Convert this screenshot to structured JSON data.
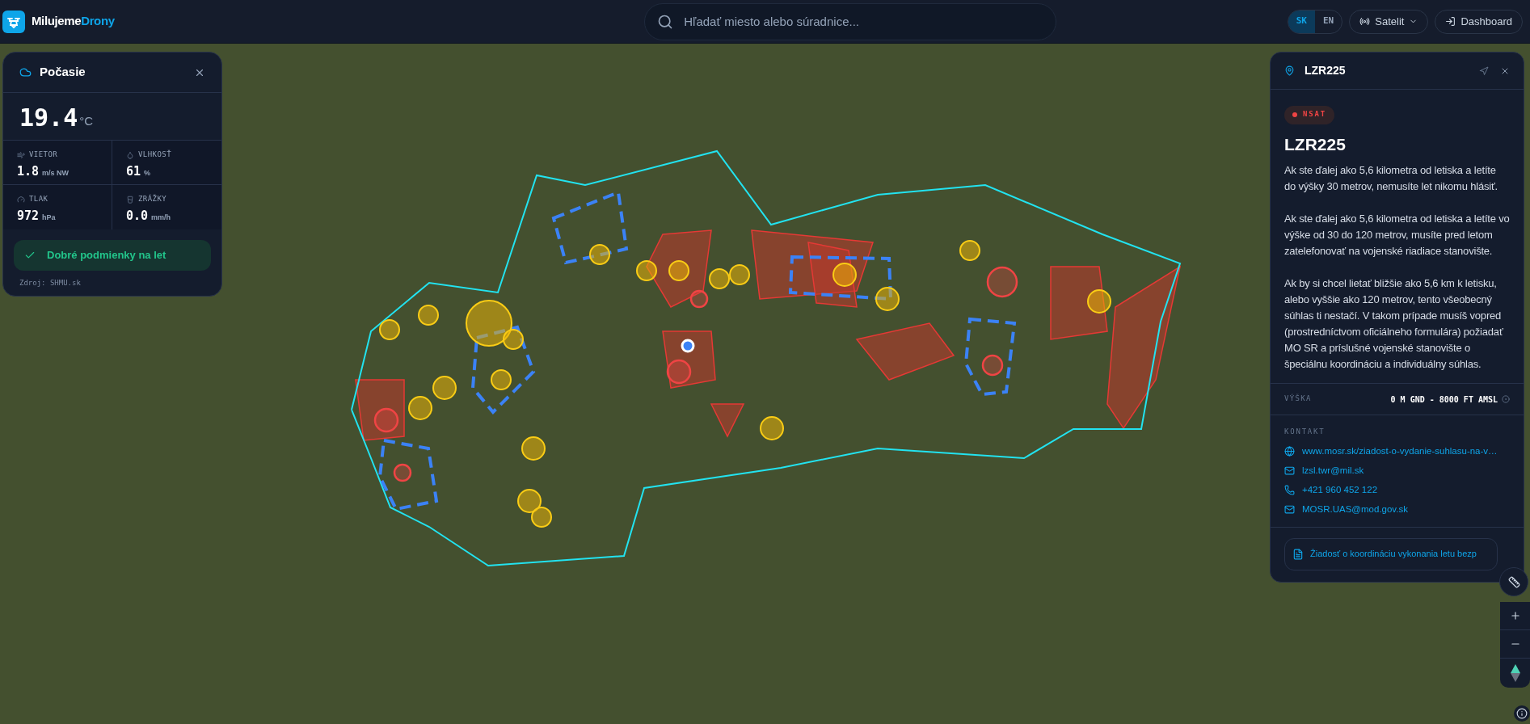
{
  "header": {
    "brand": {
      "first": "Milujeme",
      "second": "Drony"
    },
    "search": {
      "placeholder": "Hľadať miesto alebo súradnice..."
    },
    "languages": [
      {
        "label": "SK",
        "selected": true
      },
      {
        "label": "EN",
        "selected": false
      }
    ],
    "layer_button": "Satelit",
    "dashboard_button": "Dashboard"
  },
  "weather": {
    "title": "Počasie",
    "temperature": "19.4",
    "unit": "°C",
    "metrics": [
      {
        "label": "VIETOR",
        "value": "1.8",
        "unit": "m/s NW"
      },
      {
        "label": "VLHKOSŤ",
        "value": "61",
        "unit": "%"
      },
      {
        "label": "TLAK",
        "value": "972",
        "unit": "hPa"
      },
      {
        "label": "ZRÁŽKY",
        "value": "0.0",
        "unit": "mm/h"
      }
    ],
    "status": {
      "text": "Dobré podmienky na let",
      "good": true
    },
    "source": "Zdroj: SHMU.sk"
  },
  "zone": {
    "header_title": "LZR225",
    "badge": "NSAT",
    "title": "LZR225",
    "paragraphs": [
      "Ak ste ďalej ako 5,6 kilometra od letiska a letíte do výšky 30 metrov, nemusíte let nikomu hlásiť.",
      "Ak ste ďalej ako 5,6 kilometra od letiska a letíte vo výške od 30 do 120 metrov, musíte pred letom zatelefonovať na vojenské riadiace stanovište.",
      "Ak by si chcel lietať bližšie ako 5,6 km k letisku, alebo vyššie ako 120 metrov, tento všeobecný súhlas ti nestačí. V takom prípade musíš vopred (prostredníctvom oficiálneho formulára) požiadať MO SR a príslušné vojenské stanovište o špeciálnu koordináciu a individuálny súhlas."
    ],
    "altitude": {
      "label": "VÝŠKA",
      "value": "0 M GND - 8000 FT AMSL"
    },
    "contact_heading": "KONTAKT",
    "contacts": [
      {
        "kind": "web",
        "text": "www.mosr.sk/ziadost-o-vydanie-suhlasu-na-v…"
      },
      {
        "kind": "email",
        "text": "lzsl.twr@mil.sk"
      },
      {
        "kind": "phone",
        "text": "+421 960 452 122"
      },
      {
        "kind": "email",
        "text": "MOSR.UAS@mod.gov.sk"
      }
    ],
    "request_button": "Žiadosť o koordináciu vykonania letu bezp"
  }
}
